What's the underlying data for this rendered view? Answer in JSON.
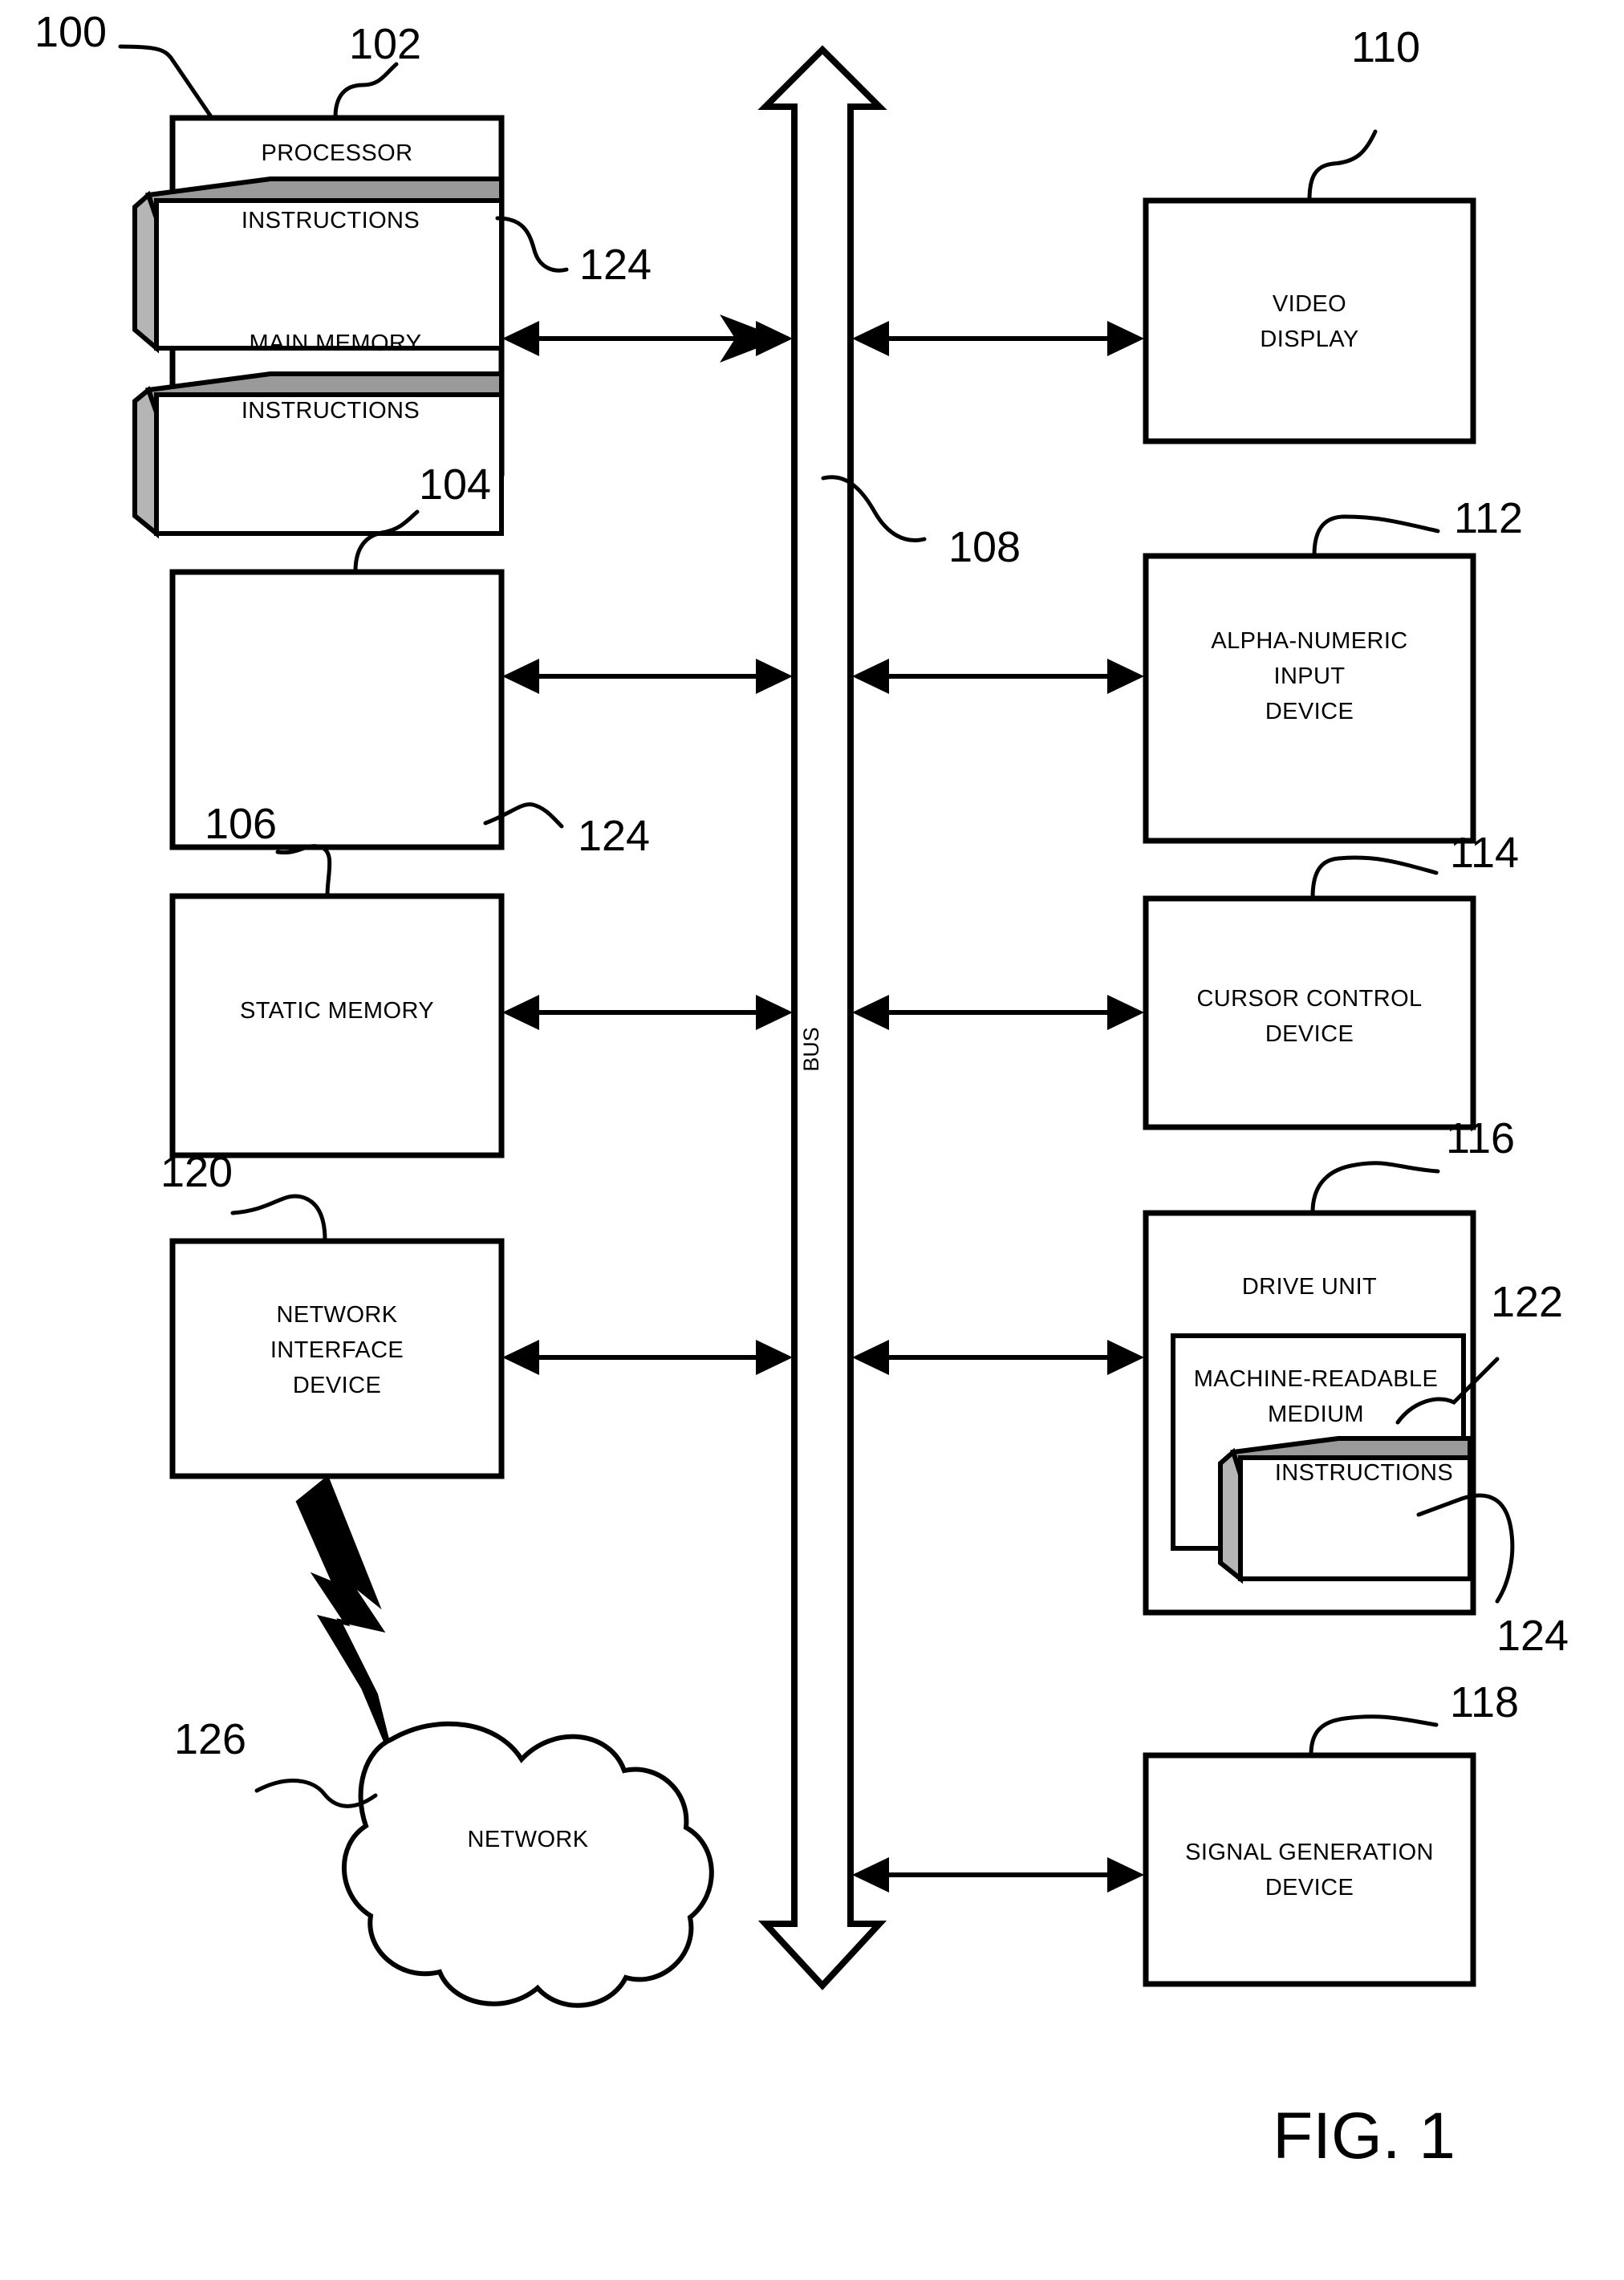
{
  "figure": {
    "caption": "FIG. 1",
    "system_ref": "100"
  },
  "refs": {
    "system": "100",
    "processor": "102",
    "main_memory": "104",
    "static_memory": "106",
    "bus": "108",
    "video_display": "110",
    "alpha_numeric": "112",
    "cursor_control": "114",
    "drive_unit": "116",
    "signal_generation": "118",
    "network_interface": "120",
    "machine_readable_medium": "122",
    "instructions_processor": "124",
    "instructions_main_memory": "124",
    "instructions_drive": "124",
    "network": "126"
  },
  "blocks": {
    "processor": {
      "label": "PROCESSOR",
      "instructions_label": "INSTRUCTIONS"
    },
    "main_memory": {
      "label": "MAIN MEMORY",
      "instructions_label": "INSTRUCTIONS"
    },
    "static_memory": {
      "label": "STATIC MEMORY"
    },
    "network_interface": {
      "line1": "NETWORK",
      "line2": "INTERFACE",
      "line3": "DEVICE"
    },
    "network_cloud": {
      "label": "NETWORK"
    },
    "video_display": {
      "line1": "VIDEO",
      "line2": "DISPLAY"
    },
    "alpha_numeric": {
      "line1": "ALPHA-NUMERIC",
      "line2": "INPUT",
      "line3": "DEVICE"
    },
    "cursor_control": {
      "line1": "CURSOR CONTROL",
      "line2": "DEVICE"
    },
    "drive_unit": {
      "label": "DRIVE UNIT",
      "medium_line1": "MACHINE-READABLE",
      "medium_line2": "MEDIUM",
      "instructions_label": "INSTRUCTIONS"
    },
    "signal_generation": {
      "line1": "SIGNAL GENERATION",
      "line2": "DEVICE"
    },
    "bus": {
      "label": "BUS"
    }
  },
  "colors": {
    "ink": "#000000",
    "paper": "#ffffff",
    "instruction_shade": "#9a9a9a"
  }
}
